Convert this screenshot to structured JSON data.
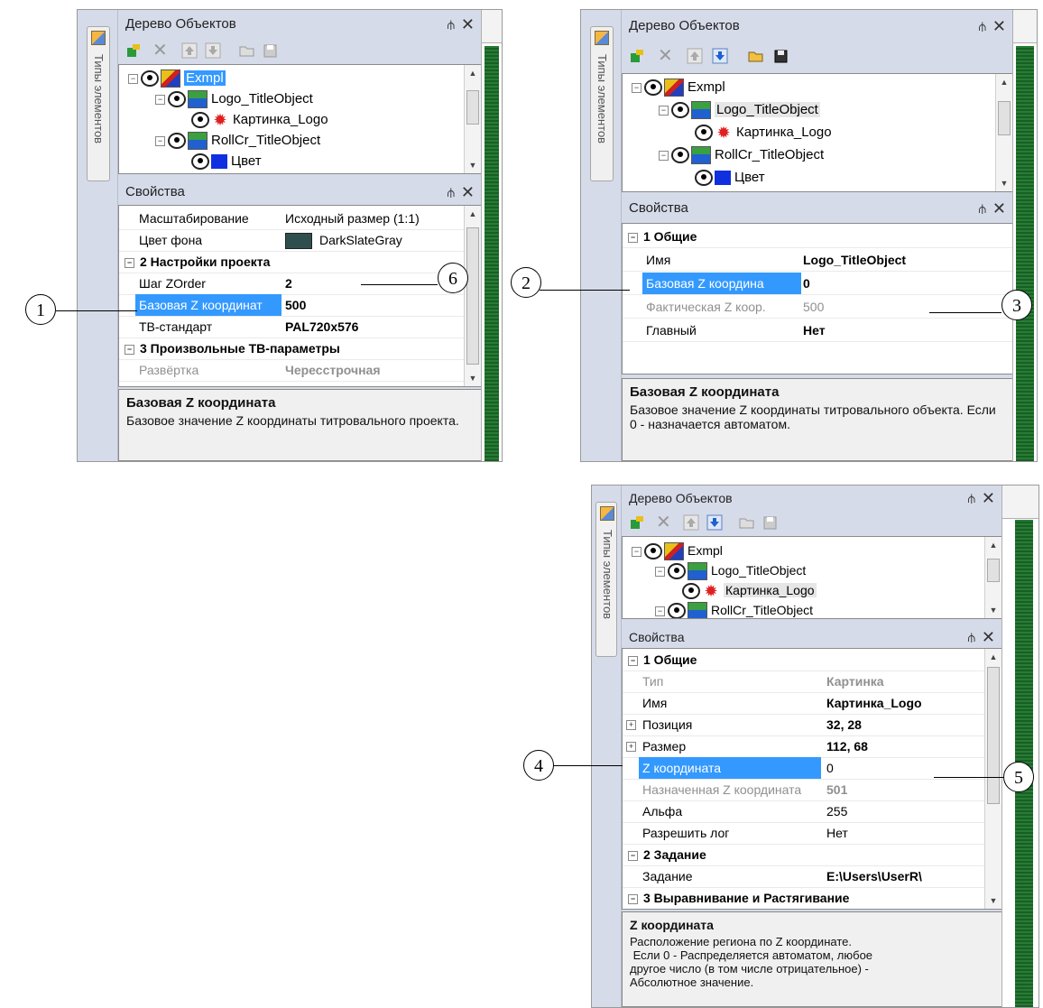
{
  "panel1": {
    "side_tab": "Типы элементов",
    "tree_title": "Дерево Объектов",
    "tree": [
      "Exmpl",
      "Logo_TitleObject",
      "Картинка_Logo",
      "RollCr_TitleObject",
      "Цвет"
    ],
    "props_title": "Свойства",
    "rows": [
      {
        "name": "Масштабирование",
        "value": "Исходный размер (1:1)"
      },
      {
        "name": "Цвет фона",
        "value": "DarkSlateGray"
      },
      {
        "cat": "2 Настройки проекта"
      },
      {
        "name": "Шаг ZOrder",
        "value": "2"
      },
      {
        "name": "Базовая Z координат",
        "value": "500"
      },
      {
        "name": "ТВ-стандарт",
        "value": "PAL720x576"
      },
      {
        "cat": "3 Произвольные ТВ-параметры"
      },
      {
        "name": "Развёртка",
        "value": "Чересстрочная"
      }
    ],
    "desc_title": "Базовая Z координата",
    "desc_text": "Базовое значение Z координаты титровального проекта."
  },
  "panel2": {
    "side_tab": "Типы элементов",
    "tree_title": "Дерево Объектов",
    "tree": [
      "Exmpl",
      "Logo_TitleObject",
      "Картинка_Logo",
      "RollCr_TitleObject",
      "Цвет"
    ],
    "props_title": "Свойства",
    "rows": [
      {
        "cat": "1 Общие"
      },
      {
        "name": "Имя",
        "value": "Logo_TitleObject"
      },
      {
        "name": "Базовая Z координа",
        "value": "0"
      },
      {
        "name": "Фактическая Z коор.",
        "value": "500"
      },
      {
        "name": "Главный",
        "value": "Нет"
      }
    ],
    "desc_title": "Базовая Z координата",
    "desc_text": "Базовое значение Z координаты титровального объекта. Если 0 - назначается автоматом."
  },
  "panel3": {
    "side_tab": "Типы элементов",
    "tree_title": "Дерево Объектов",
    "tree": [
      "Exmpl",
      "Logo_TitleObject",
      "Картинка_Logo",
      "RollCr_TitleObject"
    ],
    "props_title": "Свойства",
    "rows": [
      {
        "cat": "1 Общие"
      },
      {
        "name": "Тип",
        "value": "Картинка"
      },
      {
        "name": "Имя",
        "value": "Картинка_Logo"
      },
      {
        "name": "Позиция",
        "value": "32, 28"
      },
      {
        "name": "Размер",
        "value": "112, 68"
      },
      {
        "name": "Z координата",
        "value": "0"
      },
      {
        "name": "Назначенная Z координата",
        "value": "501"
      },
      {
        "name": "Альфа",
        "value": "255"
      },
      {
        "name": "Разрешить лог",
        "value": "Нет"
      },
      {
        "cat": "2 Задание"
      },
      {
        "name": "Задание",
        "value": "E:\\Users\\UserR\\"
      },
      {
        "cat": "3 Выравнивание и Растягивание"
      }
    ],
    "desc_title": "Z координата",
    "desc_lines": [
      "Расположение региона по Z координате.",
      " Если 0 - Распределяется автоматом, любое",
      "другое число (в том числе отрицательное) -",
      "Абсолютное значение."
    ]
  },
  "callouts": [
    "1",
    "2",
    "3",
    "4",
    "5",
    "6"
  ],
  "icons": {
    "pin": "pin-icon",
    "close": "close-icon",
    "expand": "⊟",
    "collapse": "⊞"
  },
  "colors": {
    "selection": "#3399ff",
    "green_bar": "#1f6b2c",
    "background_swatch": "#2f4f4f"
  }
}
